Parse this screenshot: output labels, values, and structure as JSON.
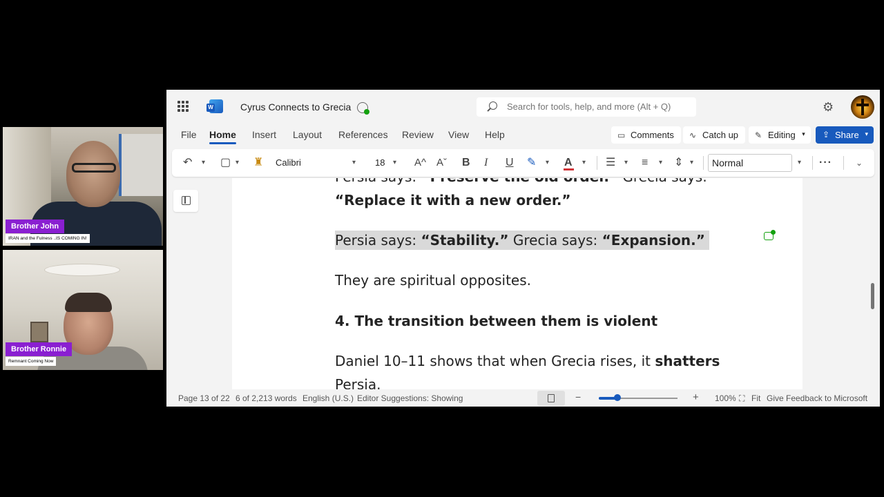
{
  "participants": [
    {
      "name": "Brother John",
      "subtitle": "IRAN and the Fulness ..IS COMING IN!"
    },
    {
      "name": "Brother Ronnie",
      "subtitle": "Remnant Coming Now"
    }
  ],
  "titlebar": {
    "doc_title": "Cyrus Connects to Grecia",
    "search_placeholder": "Search for tools, help, and more (Alt + Q)"
  },
  "menu": {
    "items": [
      "File",
      "Home",
      "Insert",
      "Layout",
      "References",
      "Review",
      "View",
      "Help"
    ],
    "active": "Home",
    "comments_label": "Comments",
    "catchup_label": "Catch up",
    "editing_label": "Editing",
    "share_label": "Share"
  },
  "ribbon": {
    "font_name": "Calibri",
    "font_size": "18",
    "style": "Normal",
    "font_color": "#d13438",
    "highlight_color": "#185abd"
  },
  "document": {
    "lines": [
      {
        "parts": [
          {
            "t": "Persia says: ",
            "b": false
          },
          {
            "t": "“Preserve the old order.”",
            "b": true
          },
          {
            "t": "  Grecia says:",
            "b": false
          }
        ]
      },
      {
        "parts": [
          {
            "t": "“Replace it with a new order.”",
            "b": true
          }
        ]
      },
      {
        "parts": [
          {
            "t": "Persia says: ",
            "b": false
          },
          {
            "t": "“Stability.”",
            "b": true
          },
          {
            "t": "  Grecia says: ",
            "b": false
          },
          {
            "t": "“Expansion.”",
            "b": true
          }
        ],
        "selected": true
      },
      {
        "parts": [
          {
            "t": "They are spiritual opposites.",
            "b": false
          }
        ]
      },
      {
        "parts": [
          {
            "t": "4. The transition between them is violent",
            "b": true
          }
        ]
      },
      {
        "parts": [
          {
            "t": "Daniel 10–11 shows that when Grecia rises, it ",
            "b": false
          },
          {
            "t": "shatters",
            "b": true
          }
        ]
      },
      {
        "parts": [
          {
            "t": "Persia.",
            "b": false
          }
        ]
      }
    ]
  },
  "statusbar": {
    "page": "Page 13 of 22",
    "words": "6 of 2,213 words",
    "language": "English (U.S.)",
    "editor": "Editor Suggestions: Showing",
    "zoom": "100%",
    "zoom_level": 0.24,
    "fit": "Fit",
    "feedback": "Give Feedback to Microsoft"
  },
  "accent_color": "#185abd",
  "tag_color": "#8a1fd1"
}
